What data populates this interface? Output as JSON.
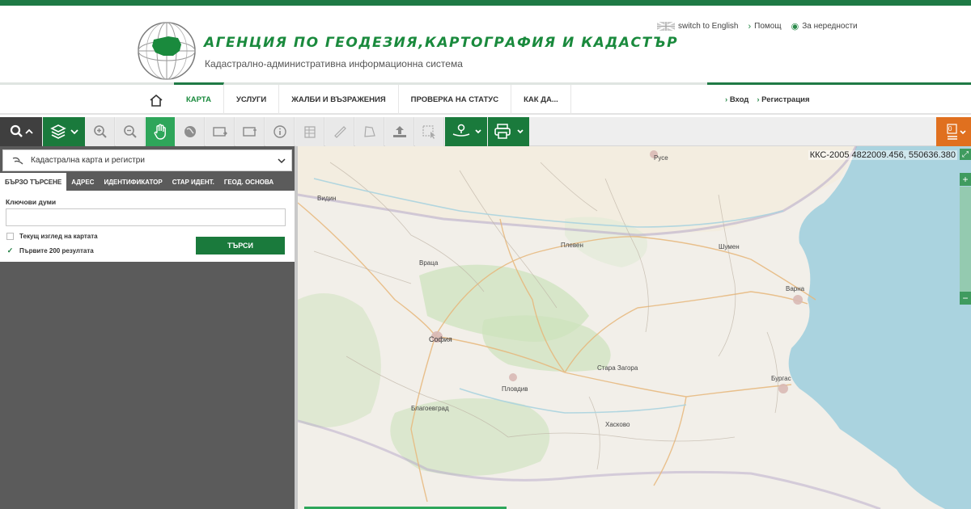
{
  "header": {
    "agency_title": "АГЕНЦИЯ ПО ГЕОДЕЗИЯ,КАРТОГРАФИЯ И КАДАСТЪР",
    "agency_subtitle": "Кадастрално-административна информационна система",
    "links": {
      "switch_lang": "switch to English",
      "help": "Помощ",
      "feedback": "За нередности"
    }
  },
  "nav": {
    "items": [
      {
        "label": "КАРТА",
        "active": true
      },
      {
        "label": "УСЛУГИ"
      },
      {
        "label": "ЖАЛБИ И ВЪЗРАЖЕНИЯ"
      },
      {
        "label": "ПРОВЕРКА НА СТАТУС"
      },
      {
        "label": "КАК ДА..."
      }
    ],
    "login": "Вход",
    "register": "Регистрация"
  },
  "toolbar": {
    "notifications_count": "0"
  },
  "left_panel": {
    "layer_select": "Кадастрална карта и регистри",
    "tabs": [
      "БЪРЗО ТЪРСЕНЕ",
      "АДРЕС",
      "ИДЕНТИФИКАТОР",
      "СТАР ИДЕНТ.",
      "ГЕОД. ОСНОВА"
    ],
    "keywords_label": "Ключови думи",
    "keywords_value": "",
    "current_view_label": "Текущ изглед на картата",
    "current_view_checked": false,
    "first200_label": "Първите 200 резултата",
    "first200_checked": true,
    "search_button": "ТЪРСИ"
  },
  "map": {
    "coordinates": "ККС-2005 4822009.456, 550636.380",
    "labels": {
      "sofia": "София",
      "varna": "Варна",
      "burgas": "Бургас",
      "plovdiv": "Пловдив",
      "vratsa": "Враца",
      "pleven": "Плевен",
      "ruse": "Русе",
      "stara_zagora": "Стара Загора",
      "shumen": "Шумен",
      "vidin": "Видин",
      "blagoevgrad": "Благоевград",
      "haskovo": "Хасково"
    }
  },
  "colors": {
    "brand_green": "#1a7a3c",
    "accent_orange": "#e0701f",
    "sea": "#aad3df",
    "land": "#f2efe9"
  }
}
